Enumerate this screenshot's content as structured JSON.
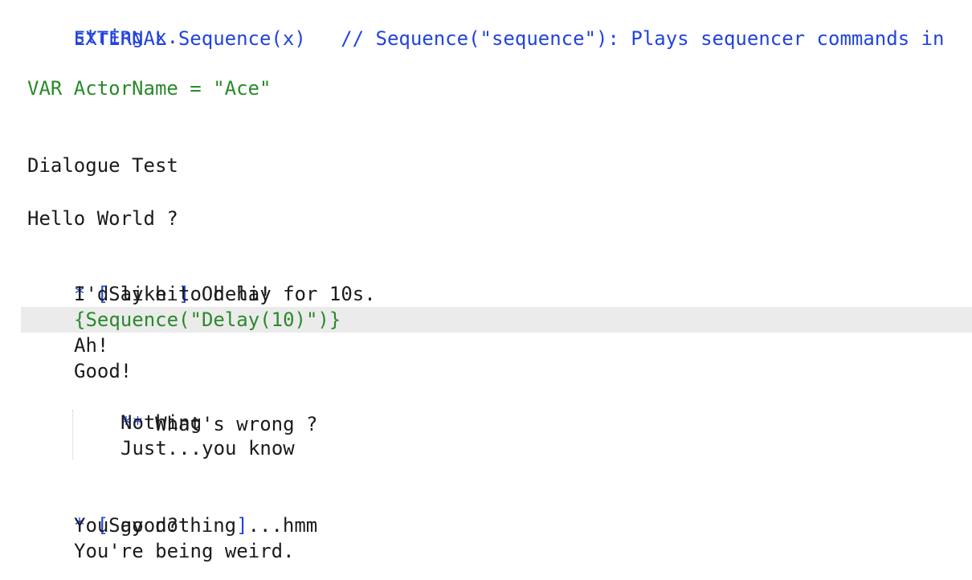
{
  "editor": {
    "accent_blue": "#2244dd",
    "accent_green": "#2a8a2a",
    "text_color": "#1b1b1b",
    "current_line_highlight": "#ebebeb",
    "lines": {
      "external_decl": "EXTERNAL Sequence(x)",
      "external_comment": "// Sequence(\"sequence\"): Plays sequencer commands in",
      "external_comment_cont": "string x.",
      "var_decl": "VAR ActorName = \"Ace\"",
      "dialogue_title": "Dialogue Test",
      "hello": "Hello World ?",
      "choice1_bullet": "*",
      "choice1_open": "[",
      "choice1_text": "Say hi",
      "choice1_close": "]",
      "choice1_rest": " Oh hi!",
      "delay_line": "I'd like to delay for 10s.",
      "sequence_call": "{Sequence(\"Delay(10)\")}",
      "ah": "Ah!",
      "good": "Good!",
      "subchoice_bullet": "**",
      "subchoice_text": " What's wrong ?",
      "nothing": "Nothing",
      "just": "Just...you know",
      "choice2_bullet": "*",
      "choice2_open": "[",
      "choice2_text": "Say nothing",
      "choice2_close": "]",
      "choice2_rest": "...hmm",
      "you_good": "You good?",
      "being_weird": "You're being weird."
    }
  }
}
